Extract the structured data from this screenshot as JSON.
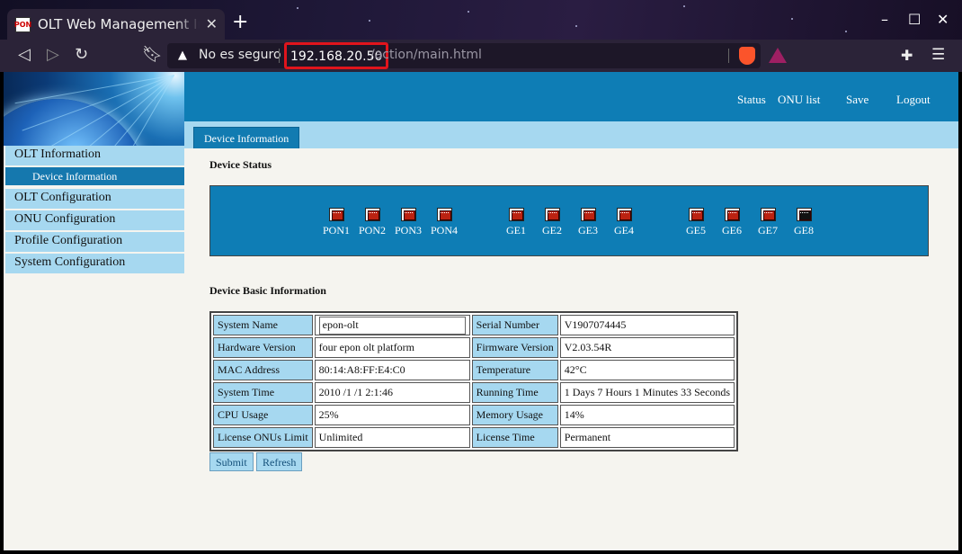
{
  "browser": {
    "tab_title": "OLT Web Management Int",
    "favicon_text": "PON",
    "new_tab": "+",
    "security_label": "No es seguro",
    "url_host": "192.168.20.50",
    "url_path": "/action/main.html"
  },
  "header": {
    "links": [
      "Status",
      "ONU list",
      "Save",
      "Logout"
    ]
  },
  "page_tab": "Device Information",
  "sidebar": {
    "items": [
      "OLT Information",
      "OLT Configuration",
      "ONU Configuration",
      "Profile Configuration",
      "System Configuration"
    ],
    "active_sub": "Device Information"
  },
  "device_status": {
    "title": "Device Status",
    "ports": [
      {
        "label": "PON1",
        "state": "down"
      },
      {
        "label": "PON2",
        "state": "down"
      },
      {
        "label": "PON3",
        "state": "down"
      },
      {
        "label": "PON4",
        "state": "down"
      },
      {
        "label": "GE1",
        "state": "down"
      },
      {
        "label": "GE2",
        "state": "down"
      },
      {
        "label": "GE3",
        "state": "down"
      },
      {
        "label": "GE4",
        "state": "down"
      },
      {
        "label": "GE5",
        "state": "down"
      },
      {
        "label": "GE6",
        "state": "down"
      },
      {
        "label": "GE7",
        "state": "down"
      },
      {
        "label": "GE8",
        "state": "up"
      }
    ]
  },
  "basic_info": {
    "title": "Device Basic Information",
    "rows": [
      {
        "l1": "System Name",
        "v1": "epon-olt",
        "l2": "Serial Number",
        "v2": "V1907074445"
      },
      {
        "l1": "Hardware Version",
        "v1": "four epon olt platform",
        "l2": "Firmware Version",
        "v2": "V2.03.54R"
      },
      {
        "l1": "MAC Address",
        "v1": "80:14:A8:FF:E4:C0",
        "l2": "Temperature",
        "v2": "42°C"
      },
      {
        "l1": "System Time",
        "v1": "2010 /1 /1 2:1:46",
        "l2": "Running Time",
        "v2": "1 Days 7 Hours 1 Minutes 33 Seconds"
      },
      {
        "l1": "CPU Usage",
        "v1": "25%",
        "l2": "Memory Usage",
        "v2": "14%"
      },
      {
        "l1": "License ONUs Limit",
        "v1": "Unlimited",
        "l2": "License Time",
        "v2": "Permanent"
      }
    ]
  },
  "buttons": {
    "submit": "Submit",
    "refresh": "Refresh"
  },
  "colors": {
    "accent": "#0e7db5",
    "light_accent": "#a6d8f0",
    "highlight": "#e0141c"
  }
}
